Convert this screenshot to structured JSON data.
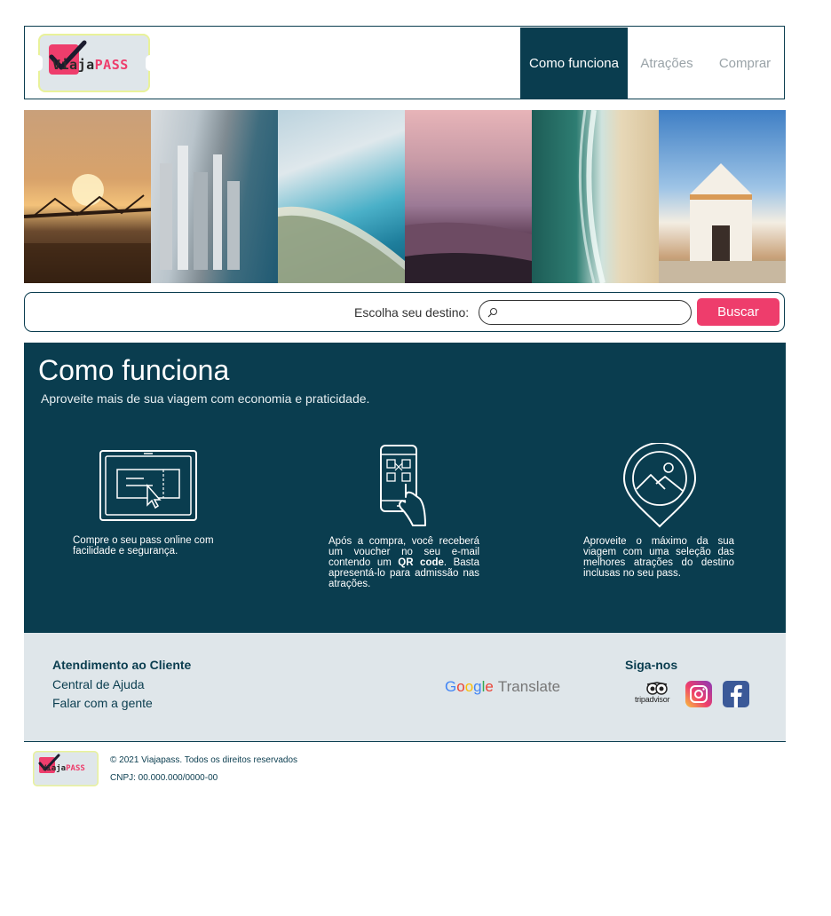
{
  "brand": {
    "logo_text_a": "iaja",
    "logo_text_v": "V",
    "logo_text_b": "PASS"
  },
  "nav": {
    "items": [
      {
        "label": "Como funciona",
        "active": true
      },
      {
        "label": "Atrações",
        "active": false
      },
      {
        "label": "Comprar",
        "active": false
      }
    ]
  },
  "gallery": {
    "photos": [
      "bridge-sunset",
      "coastal-city",
      "beach-bay",
      "city-dusk",
      "aerial-beach",
      "church"
    ]
  },
  "search": {
    "label": "Escolha seu destino:",
    "placeholder": "",
    "button_label": "Buscar"
  },
  "como": {
    "title": "Como funciona",
    "subtitle": "Aproveite mais de sua viagem com economia e praticidade.",
    "steps": [
      {
        "icon": "ticket-screen-icon",
        "text": "Compre o seu pass online com facilidade e segurança."
      },
      {
        "icon": "phone-qr-icon",
        "text_a": "Após a compra, você receberá um voucher no seu e-mail contendo um ",
        "text_bold": "QR code",
        "text_b": ". Basta apresentá-lo para admissão nas atrações."
      },
      {
        "icon": "map-pin-landscape-icon",
        "text": "Aproveite o máximo da sua viagem com uma seleção das melhores atrações do destino inclusas no seu pass."
      }
    ]
  },
  "footer": {
    "support_title": "Atendimento ao Cliente",
    "links": [
      "Central de Ajuda",
      "Falar com a gente"
    ],
    "translate_label": "Translate",
    "follow_title": "Siga-nos",
    "tripadvisor_text": "tripadvisor",
    "copyright": "© 2021 Viajapass. Todos os direitos reservados",
    "cnpj": "CNPJ: 00.000.000/0000-00"
  },
  "colors": {
    "primary": "#0a3d4f",
    "accent": "#ee3d6c",
    "footer_bg": "#dfe6ea"
  }
}
